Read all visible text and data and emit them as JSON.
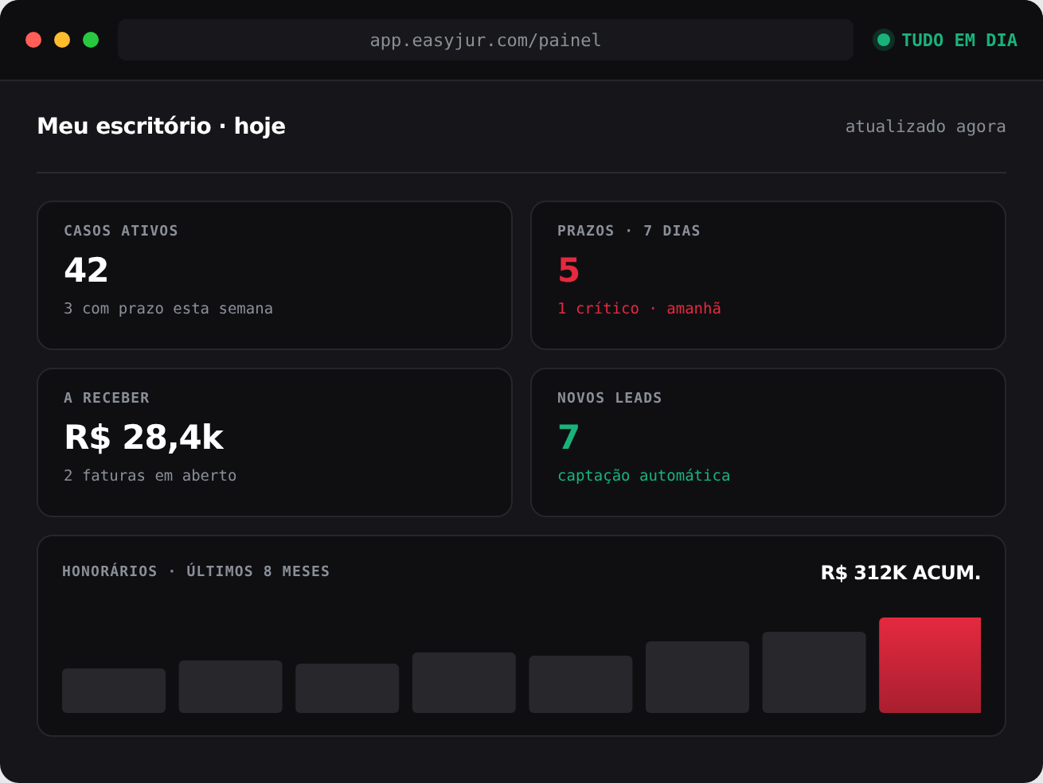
{
  "browser": {
    "url": "app.easyjur.com/painel",
    "status": {
      "label": "TUDO EM DIA",
      "color": "#19b37a"
    }
  },
  "header": {
    "title": "Meu escritório · hoje",
    "updated": "atualizado agora"
  },
  "cards": [
    {
      "label": "CASOS ATIVOS",
      "value": "42",
      "note": "3 com prazo esta semana",
      "kind": "neutral"
    },
    {
      "label": "PRAZOS · 7 DIAS",
      "value": "5",
      "note": "1 crítico · amanhã",
      "kind": "danger"
    },
    {
      "label": "A RECEBER",
      "value": "R$ 28,4k",
      "note": "2 faturas em aberto",
      "kind": "neutral"
    },
    {
      "label": "NOVOS LEADS",
      "value": "7",
      "note": "captação automática",
      "kind": "success"
    }
  ],
  "revenue": {
    "label": "HONORÁRIOS · ÚLTIMOS 8 MESES",
    "total": "R$ 312K ACUM."
  }
}
